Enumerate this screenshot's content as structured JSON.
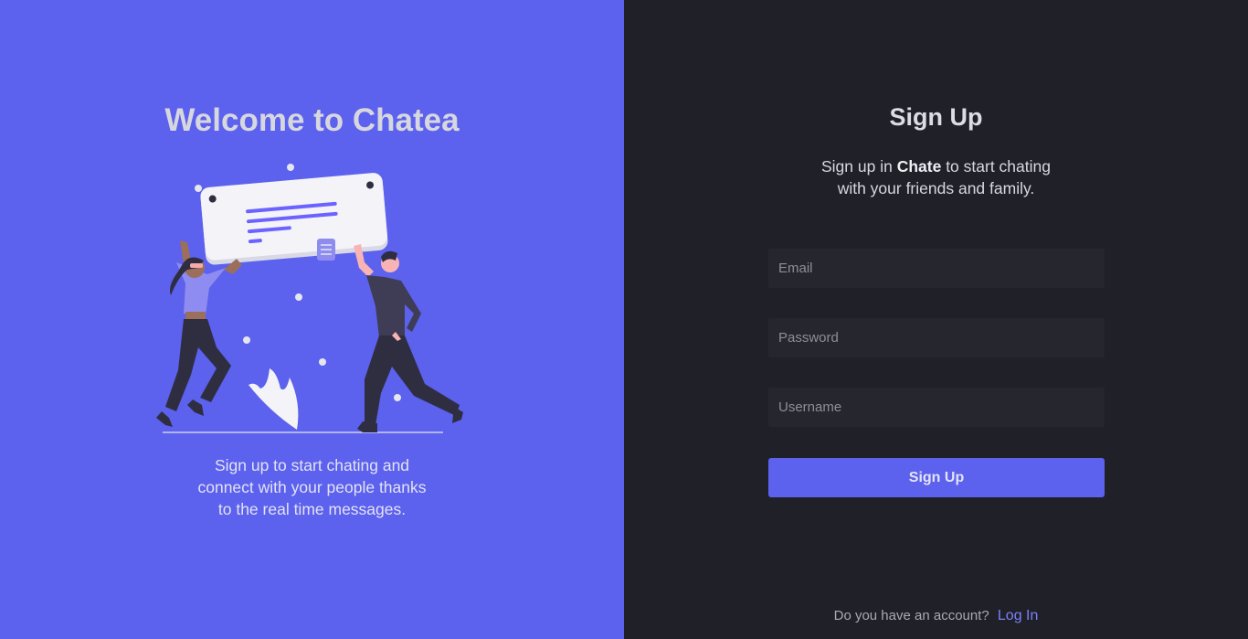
{
  "welcome": {
    "title": "Welcome to Chatea",
    "description_lines": [
      "Sign up to start chating and",
      "connect with your people thanks",
      "to the real time messages."
    ]
  },
  "signup": {
    "title": "Sign Up",
    "subtitle_prefix": "Sign up in ",
    "subtitle_brand": "Chate",
    "subtitle_suffix": " to start chating",
    "subtitle_line2": "with your friends and family.",
    "email_placeholder": "Email",
    "password_placeholder": "Password",
    "username_placeholder": "Username",
    "button_label": "Sign Up",
    "account_prompt": "Do you have an account?",
    "login_label": "Log In"
  },
  "colors": {
    "accent": "#5c61ee",
    "dark_bg": "#202029",
    "input_bg": "#26262e",
    "link": "#7b80f7"
  }
}
